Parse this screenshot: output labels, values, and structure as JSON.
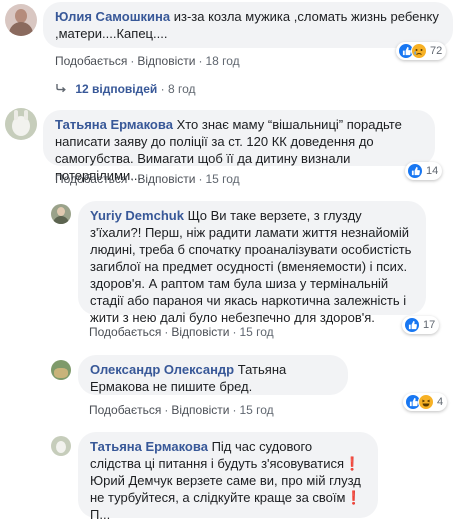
{
  "comments": [
    {
      "author": "Юлия Самошкина",
      "text": "из-за козла мужика ,сломать жизнь ребенку ,матери....Капец....",
      "like": "Подобається",
      "reply": "Відповісти",
      "time": "18 год",
      "reactions": [
        "like-icon",
        "sad-icon"
      ],
      "reaction_count": "72"
    },
    {
      "author": "Татьяна Ермакова",
      "text": "Хто знає маму “вішальниці” порадьте написати заяву до поліції за ст. 120 КК доведення до самогубства. Вимагати щоб її да дитину визнали потерпілими...",
      "like": "Подобається",
      "reply": "Відповісти",
      "time": "15 год",
      "reactions": [
        "like-icon"
      ],
      "reaction_count": "14"
    }
  ],
  "replies_toggle": {
    "label": "12 відповідей",
    "time": "8 год"
  },
  "replies": [
    {
      "author": "Yuriy Demchuk",
      "text": "Що Ви таке верзете, з глузду з'їхали?! Перш, ніж радити ламати життя незнайомій людині, треба б спочатку проаналізувати особистість загиблої на предмет осудності (вменяемости) і псих. здоров'я. А раптом там була шиза у термінальній стадії або параноя чи якась наркотична залежність і жити з нею далі було небезпечно для здоров'я.",
      "like": "Подобається",
      "reply": "Відповісти",
      "time": "15 год",
      "reactions": [
        "like-icon"
      ],
      "reaction_count": "17"
    },
    {
      "author": "Олександр Олександр",
      "text": "Татьяна Ермакова не пишите бред.",
      "like": "Подобається",
      "reply": "Відповісти",
      "time": "15 год",
      "reactions": [
        "like-icon",
        "haha-icon"
      ],
      "reaction_count": "4"
    },
    {
      "author": "Татьяна Ермакова",
      "text_line1": "Під час судового слідства ці питання і будуть з'ясовуватися❗",
      "text_line2": "Юрий Демчук верзете саме ви, про мій глузд не турбуйтеся, а слідкуйте краще за своїм❗",
      "text_line3": "П..."
    }
  ],
  "colors": {
    "link": "#385898",
    "bubble": "#f2f3f5",
    "meta": "#606770",
    "like_blue": "#1877f2"
  }
}
